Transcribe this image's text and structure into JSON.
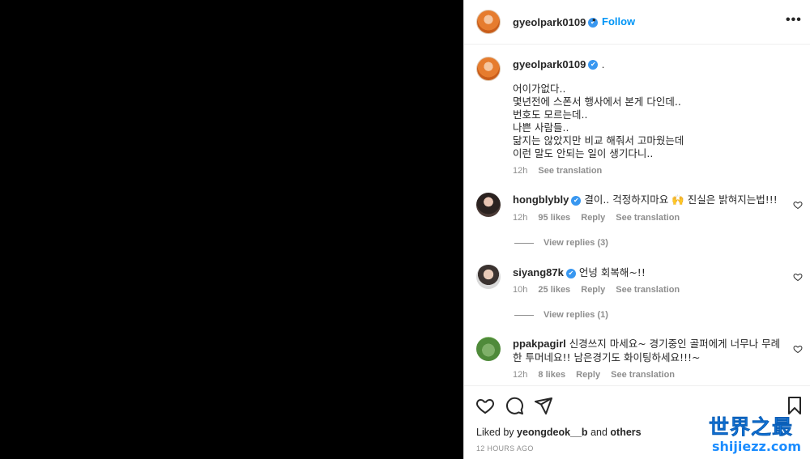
{
  "header": {
    "username": "gyeolpark0109",
    "verified_mark": "✔",
    "separator": "•",
    "follow_label": "Follow",
    "more_label": "•••"
  },
  "caption": {
    "username": "gyeolpark0109",
    "verified_mark": "✔",
    "trailing": ".",
    "text": "어이가없다..\n몇년전에 스폰서 행사에서 본게 다인데..\n번호도 모르는데..\n나쁜 사람들..\n닮지는 않았지만 비교 해줘서 고마웠는데\n이런 말도 안되는 일이 생기다니..",
    "time": "12h",
    "see_translation": "See translation"
  },
  "comments": [
    {
      "username": "hongblybly",
      "verified_mark": "✔",
      "text": "결이.. 걱정하지마요 🙌 진실은 밝혀지는법!!!",
      "time": "12h",
      "likes": "95 likes",
      "reply": "Reply",
      "see_translation": "See translation",
      "view_replies": "View replies (3)"
    },
    {
      "username": "siyang87k",
      "verified_mark": "✔",
      "text": "언넝 회복해~!!",
      "time": "10h",
      "likes": "25 likes",
      "reply": "Reply",
      "see_translation": "See translation",
      "view_replies": "View replies (1)"
    },
    {
      "username": "ppakpagirl",
      "text": "신경쓰지 마세요~ 경기중인 골퍼에게 너무나 무례한 투머네요!! 남은경기도 화이팅하세요!!!~",
      "time": "12h",
      "likes": "8 likes",
      "reply": "Reply",
      "see_translation": "See translation"
    }
  ],
  "footer": {
    "liked_prefix": "Liked by",
    "liked_user": "yeongdeok__b",
    "liked_suffix": "and",
    "liked_others": "others",
    "timestamp": "12 HOURS AGO"
  },
  "watermark": {
    "title": "世界之最",
    "subtitle": "shijiezz.com"
  },
  "colors": {
    "link": "#0095f6",
    "verified": "#3897f0",
    "muted": "#8e8e8e",
    "text": "#262626",
    "watermark": "#1a8cff"
  }
}
